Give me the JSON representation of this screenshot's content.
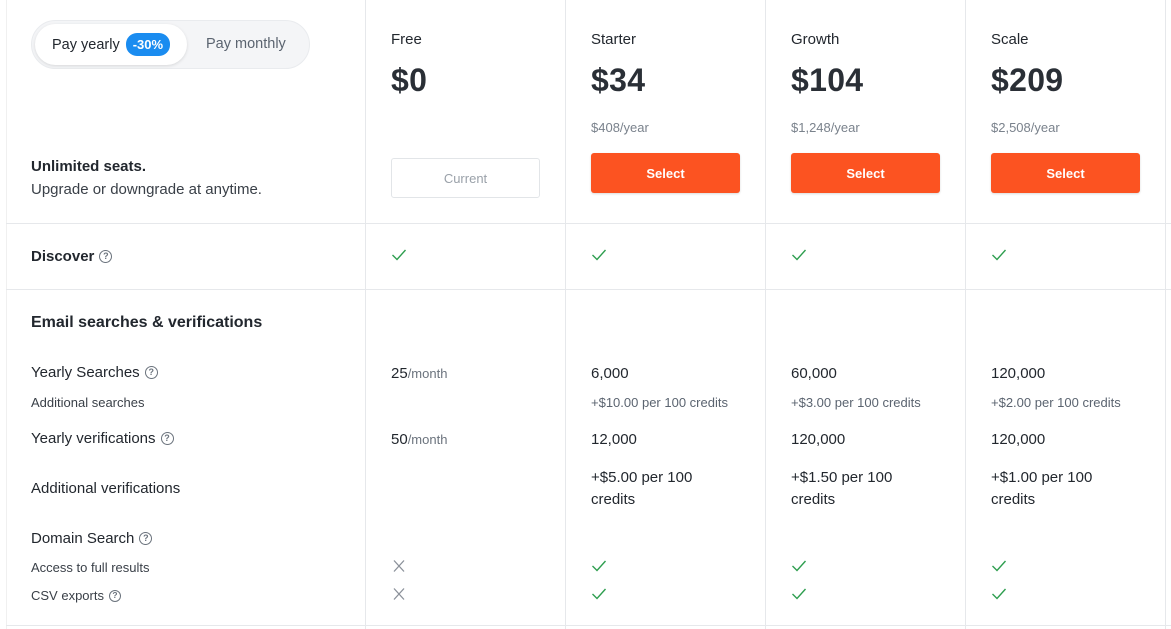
{
  "billing": {
    "yearly_label": "Pay yearly",
    "discount": "-30%",
    "monthly_label": "Pay monthly"
  },
  "intro": {
    "title": "Unlimited seats.",
    "subtitle": "Upgrade or downgrade at anytime."
  },
  "plans": [
    {
      "name": "Free",
      "price": "$0",
      "year": "",
      "button": "Current"
    },
    {
      "name": "Starter",
      "price": "$34",
      "year": "$408/year",
      "button": "Select"
    },
    {
      "name": "Growth",
      "price": "$104",
      "year": "$1,248/year",
      "button": "Select"
    },
    {
      "name": "Scale",
      "price": "$209",
      "year": "$2,508/year",
      "button": "Select"
    }
  ],
  "features": {
    "discover": "Discover",
    "email_section": "Email searches & verifications",
    "yearly_searches": "Yearly Searches",
    "additional_searches": "Additional searches",
    "yearly_verifications": "Yearly verifications",
    "additional_verifications": "Additional verifications",
    "domain_search": "Domain Search",
    "full_results": "Access to full results",
    "csv_exports": "CSV exports"
  },
  "values": {
    "free": {
      "searches": "25",
      "searches_unit": "/month",
      "verifications": "50",
      "verifications_unit": "/month"
    },
    "starter": {
      "searches": "6,000",
      "additional_searches": "+$10.00 per 100 credits",
      "verifications": "12,000",
      "additional_verifications": "+$5.00 per 100 credits"
    },
    "growth": {
      "searches": "60,000",
      "additional_searches": "+$3.00 per 100 credits",
      "verifications": "120,000",
      "additional_verifications": "+$1.50 per 100 credits"
    },
    "scale": {
      "searches": "120,000",
      "additional_searches": "+$2.00 per 100 credits",
      "verifications": "120,000",
      "additional_verifications": "+$1.00 per 100 credits"
    }
  },
  "icons": {
    "help": "?",
    "check": "check-icon",
    "cross": "cross-icon"
  },
  "colors": {
    "accent": "#fc5321",
    "badge": "#1a8cf0",
    "check": "#2e9e4f",
    "cross": "#8a9099"
  }
}
